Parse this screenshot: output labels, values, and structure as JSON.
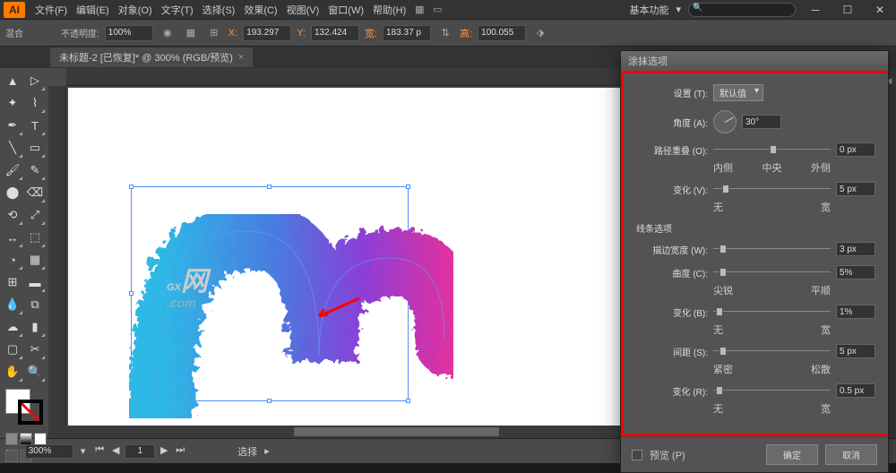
{
  "menubar": {
    "items": [
      "文件(F)",
      "编辑(E)",
      "对象(O)",
      "文字(T)",
      "选择(S)",
      "效果(C)",
      "视图(V)",
      "窗口(W)",
      "帮助(H)"
    ],
    "right_label": "基本功能"
  },
  "controlbar": {
    "blend_label": "混合",
    "opacity_label": "不透明度:",
    "opacity_value": "100%",
    "x_label": "X:",
    "x_value": "193.297",
    "y_label": "Y:",
    "y_value": "132.424",
    "w_label": "宽:",
    "w_value": "183.37 p",
    "h_label": "高:",
    "h_value": "100.055"
  },
  "tab": {
    "title": "未标题-2 [已恢复]* @ 300% (RGB/预览)"
  },
  "watermark": {
    "main": "GX",
    "sub": ".com",
    "suffix": "网"
  },
  "dialog": {
    "title": "涂抹选项",
    "settings_label": "设置 (T):",
    "settings_value": "默认值",
    "angle_label": "角度 (A):",
    "angle_value": "30°",
    "overlap_label": "路径重叠 (O):",
    "overlap_value": "0 px",
    "overlap_left": "内侧",
    "overlap_mid": "中央",
    "overlap_right": "外侧",
    "variation_v_label": "变化 (V):",
    "variation_v_value": "5 px",
    "var_left": "无",
    "var_right": "宽",
    "line_section": "线条选项",
    "stroke_label": "描边宽度 (W):",
    "stroke_value": "3 px",
    "curve_label": "曲度 (C):",
    "curve_value": "5%",
    "curve_left": "尖锐",
    "curve_right": "平顺",
    "variation_b_label": "变化 (B):",
    "variation_b_value": "1%",
    "spacing_label": "间距 (S):",
    "spacing_value": "5 px",
    "spacing_left": "紧密",
    "spacing_right": "松散",
    "variation_r_label": "变化 (R):",
    "variation_r_value": "0.5 px",
    "preview_label": "预览 (P)",
    "ok": "确定",
    "cancel": "取消"
  },
  "statusbar": {
    "zoom": "300%",
    "tool_label": "选择",
    "page": "1"
  }
}
